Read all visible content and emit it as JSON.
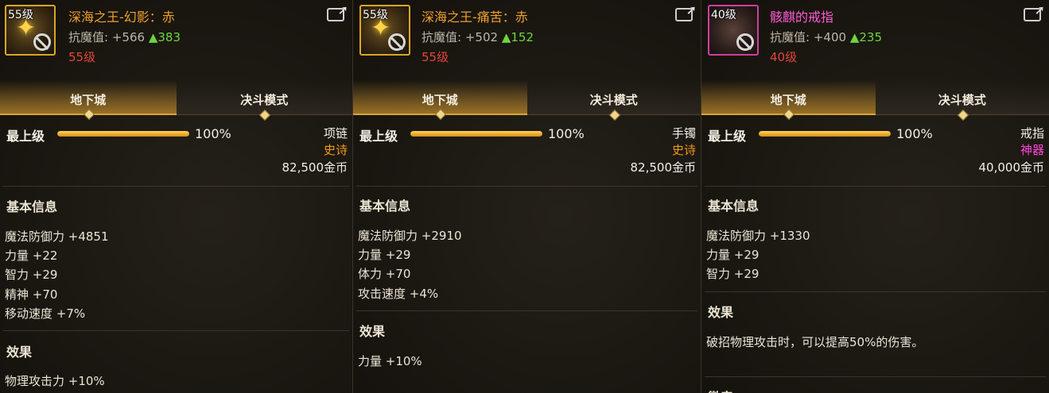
{
  "tabs": {
    "dungeon": "地下城",
    "duel": "决斗模式"
  },
  "items": [
    {
      "level_tag": "55级",
      "name": "深海之王-幻影：赤",
      "resist_label": "抗魔值:",
      "resist_value": "+566",
      "resist_delta": "▲383",
      "required_level": "55级",
      "rank_label": "最上级",
      "rank_percent": "100%",
      "rank_fill": 1.0,
      "slot": "项链",
      "rarity": "史诗",
      "price": "82,500金币",
      "basic_title": "基本信息",
      "stats": [
        "魔法防御力 +4851",
        "力量 +22",
        "智力 +29",
        "精神 +70",
        "移动速度 +7%"
      ],
      "effect_title": "效果",
      "effect_text": "物理攻击力 +10%"
    },
    {
      "level_tag": "55级",
      "name": "深海之王-痛苦：赤",
      "resist_label": "抗魔值:",
      "resist_value": "+502",
      "resist_delta": "▲152",
      "required_level": "55级",
      "rank_label": "最上级",
      "rank_percent": "100%",
      "rank_fill": 1.0,
      "slot": "手镯",
      "rarity": "史诗",
      "price": "82,500金币",
      "basic_title": "基本信息",
      "stats": [
        "魔法防御力 +2910",
        "力量 +29",
        "体力 +70",
        "攻击速度 +4%"
      ],
      "effect_title": "效果",
      "effect_text": "力量 +10%"
    },
    {
      "level_tag": "40级",
      "name": "骸麒的戒指",
      "resist_label": "抗魔值:",
      "resist_value": "+400",
      "resist_delta": "▲235",
      "required_level": "40级",
      "rank_label": "最上级",
      "rank_percent": "100%",
      "rank_fill": 1.0,
      "slot": "戒指",
      "rarity": "神器",
      "price": "40,000金币",
      "basic_title": "基本信息",
      "stats": [
        "魔法防御力 +1330",
        "力量 +29",
        "智力 +29"
      ],
      "effect_title": "效果",
      "effect_text": "破招物理攻击时，可以提高50%的伤害。",
      "extra_title": "微章"
    }
  ],
  "colors": {
    "epic": "#f09a1a",
    "myth": "#ff44d8",
    "gold_accent": "#d9a626",
    "up_green": "#6fd43c",
    "req_red": "#e2453a"
  },
  "icons": {
    "share": "share-icon",
    "ban": "ban-icon"
  }
}
